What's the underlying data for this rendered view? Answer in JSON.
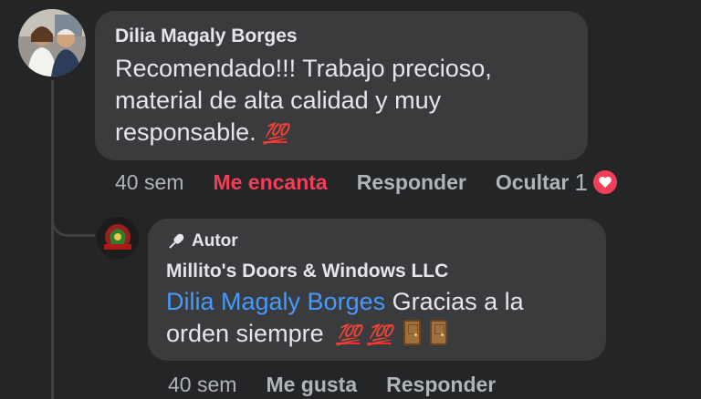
{
  "comment": {
    "author": "Dilia Magaly Borges",
    "text_line1": "Recomendado!!! Trabajo precioso,",
    "text_line2": "material de alta calidad  y muy",
    "text_line3": "responsable.",
    "emoji": "💯",
    "actions": {
      "time": "40 sem",
      "reaction": "Me encanta",
      "reply": "Responder",
      "hide": "Ocultar",
      "reaction_count": "1"
    }
  },
  "reply": {
    "badge_label": "Autor",
    "author": "Millito's Doors & Windows LLC",
    "mention": "Dilia Magaly Borges",
    "text_part1": " Gracias a la",
    "text_line2": "orden siempre",
    "emojis": [
      "💯",
      "💯",
      "🚪",
      "🚪"
    ],
    "actions": {
      "time": "40 sem",
      "like": "Me gusta",
      "reply": "Responder"
    }
  },
  "colors": {
    "background": "#242526",
    "bubble": "#3a3b3c",
    "love": "#f33e58",
    "mention": "#4599ff",
    "muted": "#b0b3b8"
  },
  "icons": {
    "author_badge": "microphone-icon",
    "reaction": "heart-icon"
  }
}
